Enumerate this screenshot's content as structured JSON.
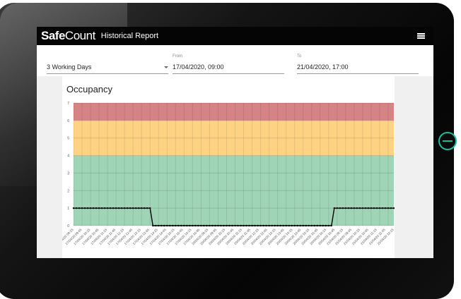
{
  "app": {
    "logo_bold": "Safe",
    "logo_light": "Count",
    "title": "Historical Report"
  },
  "icons": {
    "menu": "hamburger-menu-icon",
    "power": "power-icon"
  },
  "filters": {
    "period": {
      "value": "3 Working Days"
    },
    "from": {
      "label": "From",
      "value": "17/04/2020, 09:00"
    },
    "to": {
      "label": "To",
      "value": "21/04/2020, 17:00"
    }
  },
  "colors": {
    "red_zone": "#d58385",
    "amber_zone": "#fdd283",
    "green_zone": "#9fd4b7",
    "line": "#000000",
    "accent": "#1abc9c"
  },
  "chart_data": {
    "type": "line",
    "title": "Occupancy",
    "ylim": [
      0,
      7
    ],
    "yticks": [
      0,
      1,
      2,
      3,
      4,
      5,
      6,
      7
    ],
    "zones": [
      {
        "from": 0,
        "to": 4,
        "color": "#9fd4b7"
      },
      {
        "from": 4,
        "to": 6,
        "color": "#fdd283"
      },
      {
        "from": 6,
        "to": 7,
        "color": "#d58385"
      }
    ],
    "grid": true,
    "x_start": "17/04/2020 09:15",
    "x": [
      "17/04/20 09:15",
      "17/04/20 09:45",
      "17/04/20 10:15",
      "17/04/20 10:45",
      "17/04/20 11:15",
      "17/04/20 11:45",
      "17/04/20 12:15",
      "17/04/20 12:45",
      "17/04/20 13:15",
      "17/04/20 13:45",
      "17/04/20 14:15",
      "17/04/20 14:45",
      "17/04/20 15:15",
      "17/04/20 15:45",
      "17/04/20 16:15",
      "17/04/20 16:45",
      "20/04/20 09:15",
      "20/04/20 09:45",
      "20/04/20 10:15",
      "20/04/20 10:45",
      "20/04/20 11:15",
      "20/04/20 11:45",
      "20/04/20 12:15",
      "20/04/20 12:45",
      "20/04/20 13:15",
      "20/04/20 13:45",
      "20/04/20 14:15",
      "20/04/20 14:45",
      "20/04/20 15:15",
      "20/04/20 15:45",
      "20/04/20 16:15",
      "20/04/20 16:45",
      "21/04/20 09:15",
      "21/04/20 09:45",
      "21/04/20 10:15",
      "21/04/20 10:45",
      "21/04/20 11:15",
      "21/04/20 11:45",
      "21/04/20 12:15"
    ],
    "series": [
      {
        "values": [
          1,
          1,
          1,
          1,
          1,
          1,
          1,
          1,
          1,
          1,
          1,
          1,
          1,
          1,
          1,
          1,
          1,
          1,
          1,
          1,
          1,
          1,
          1,
          1,
          1,
          1,
          1,
          1,
          0,
          0,
          0,
          0,
          0,
          0,
          0,
          0,
          0,
          0,
          0,
          0,
          0,
          0,
          0,
          0,
          0,
          0,
          0,
          0,
          0,
          0,
          0,
          0,
          0,
          0,
          0,
          0,
          0,
          0,
          0,
          0,
          0,
          0,
          0,
          0,
          0,
          0,
          0,
          0,
          0,
          0,
          0,
          0,
          0,
          0,
          0,
          0,
          0,
          0,
          0,
          0,
          0,
          0,
          0,
          0,
          0,
          0,
          0,
          0,
          0,
          0,
          0,
          0,
          1,
          1,
          1,
          1,
          1,
          1,
          1,
          1,
          1,
          1,
          1,
          1,
          1,
          1,
          1,
          1,
          1,
          1,
          1,
          1,
          1,
          1
        ]
      }
    ]
  }
}
